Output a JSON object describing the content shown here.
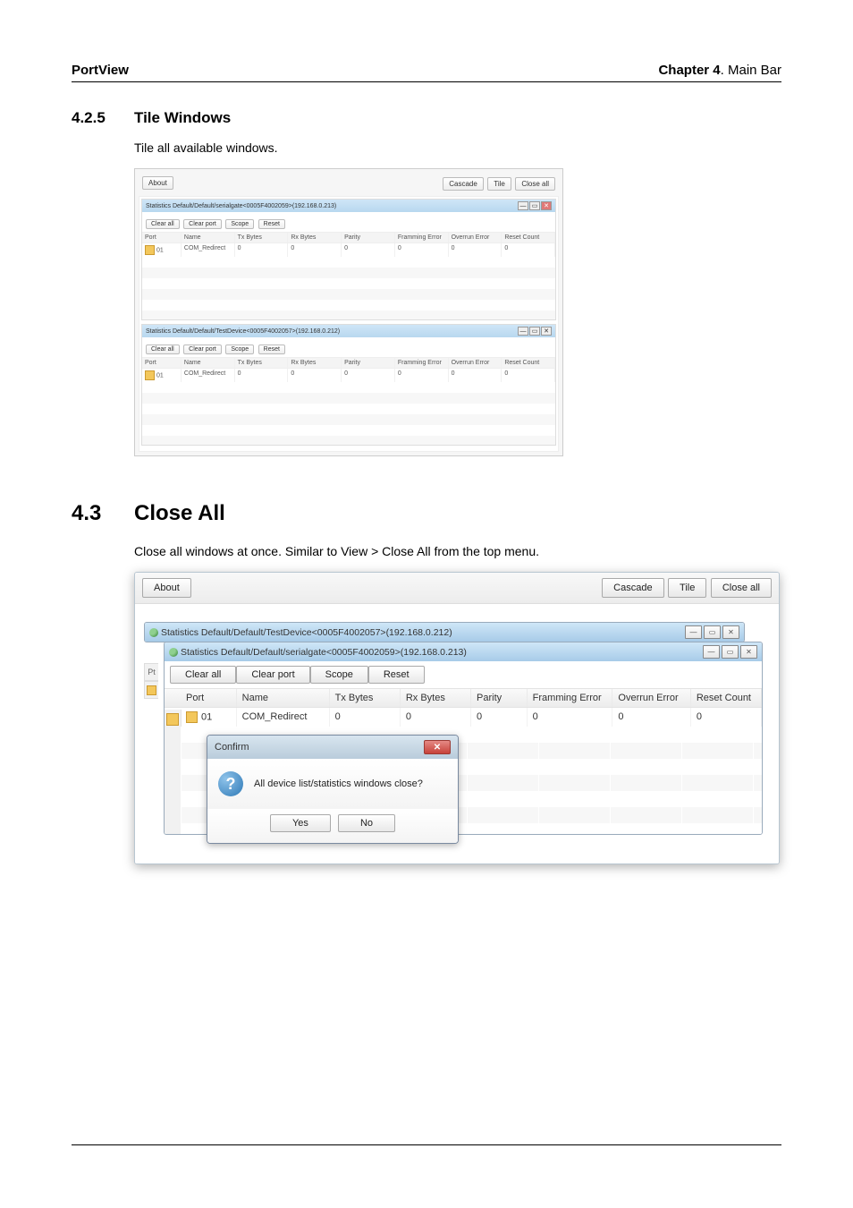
{
  "header": {
    "left": "PortView",
    "right_bold": "Chapter 4",
    "right_rest": ". Main Bar"
  },
  "s1": {
    "num": "4.2.5",
    "title": "Tile Windows",
    "body": "Tile all available windows."
  },
  "s2": {
    "num": "4.3",
    "title": "Close All",
    "body": "Close all windows at once. Similar to View > Close All from the top menu."
  },
  "common": {
    "about": "About",
    "cascade": "Cascade",
    "tile": "Tile",
    "close_all": "Close all",
    "clear_all": "Clear all",
    "clear_port": "Clear port",
    "scope": "Scope",
    "reset": "Reset",
    "min": "—",
    "max": "▭",
    "x": "✕"
  },
  "cols": {
    "port": "Port",
    "name": "Name",
    "tx": "Tx Bytes",
    "rx": "Rx Bytes",
    "parity": "Parity",
    "framming": "Framming Error",
    "overrun": "Overrun Error",
    "resetc": "Reset Count"
  },
  "figA": {
    "win1_title": "Statistics Default/Default/serialgate<0005F4002059>(192.168.0.213)",
    "win2_title": "Statistics Default/Default/TestDevice<0005F4002057>(192.168.0.212)",
    "row": {
      "port": "01",
      "name": "COM_Redirect",
      "tx": "0",
      "rx": "0",
      "parity": "0",
      "framming": "0",
      "overrun": "0",
      "resetc": "0"
    }
  },
  "figB": {
    "back_title": "Statistics Default/Default/TestDevice<0005F4002057>(192.168.0.212)",
    "front_title": "Statistics Default/Default/serialgate<0005F4002059>(192.168.0.213)",
    "left_strip_label": "Pt",
    "row": {
      "port": "01",
      "name": "COM_Redirect",
      "tx": "0",
      "rx": "0",
      "parity": "0",
      "framming": "0",
      "overrun": "0",
      "resetc": "0"
    }
  },
  "dialog": {
    "title": "Confirm",
    "message": "All device list/statistics windows close?",
    "yes": "Yes",
    "no": "No",
    "qmark": "?"
  }
}
